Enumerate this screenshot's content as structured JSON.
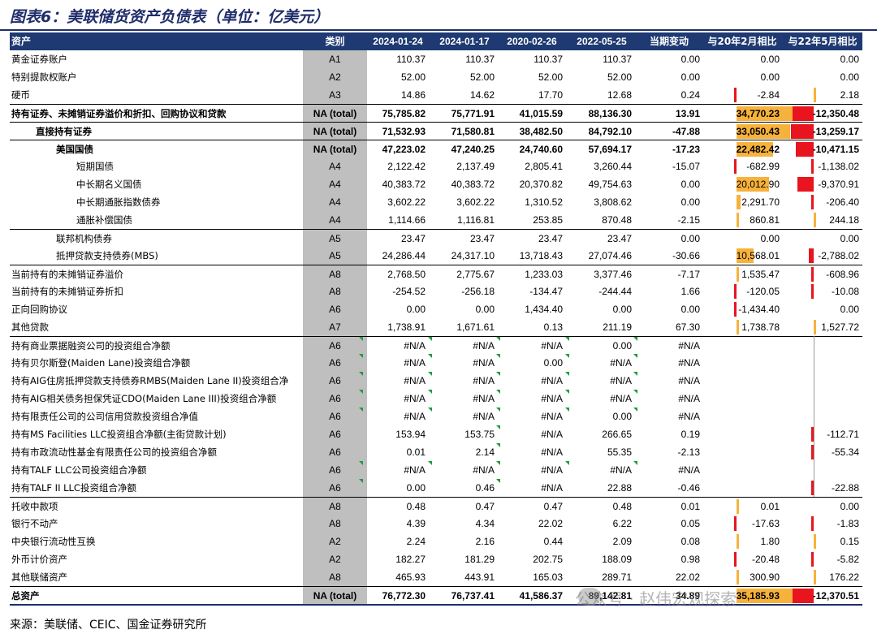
{
  "title": "图表6：美联储货资产负债表（单位：亿美元）",
  "headers": [
    "资产",
    "类别",
    "2024-01-24",
    "2024-01-17",
    "2020-02-26",
    "2022-05-25",
    "当期变动",
    "与20年2月相比",
    "与22年5月相比"
  ],
  "rows": [
    {
      "label": "黄金证券账户",
      "cat": "A1",
      "v": [
        "110.37",
        "110.37",
        "110.37",
        "110.37",
        "0.00",
        "0.00",
        "0.00"
      ]
    },
    {
      "label": "特别提款权账户",
      "cat": "A2",
      "v": [
        "52.00",
        "52.00",
        "52.00",
        "52.00",
        "0.00",
        "0.00",
        "0.00"
      ]
    },
    {
      "label": "硬币",
      "cat": "A3",
      "v": [
        "14.86",
        "14.62",
        "17.70",
        "12.68",
        "0.24",
        "-2.84",
        "2.18"
      ]
    },
    {
      "label": "持有证券、未摊销证券溢价和折扣、回购协议和贷款",
      "cat": "NA (total)",
      "v": [
        "75,785.82",
        "75,771.91",
        "41,015.59",
        "88,136.30",
        "13.91",
        "34,770.23",
        "-12,350.48"
      ]
    },
    {
      "label": "直接持有证券",
      "cat": "NA (total)",
      "v": [
        "71,532.93",
        "71,580.81",
        "38,482.50",
        "84,792.10",
        "-47.88",
        "33,050.43",
        "-13,259.17"
      ]
    },
    {
      "label": "美国国债",
      "cat": "NA (total)",
      "v": [
        "47,223.02",
        "47,240.25",
        "24,740.60",
        "57,694.17",
        "-17.23",
        "22,482.42",
        "-10,471.15"
      ]
    },
    {
      "label": "短期国债",
      "cat": "A4",
      "v": [
        "2,122.42",
        "2,137.49",
        "2,805.41",
        "3,260.44",
        "-15.07",
        "-682.99",
        "-1,138.02"
      ]
    },
    {
      "label": "中长期名义国债",
      "cat": "A4",
      "v": [
        "40,383.72",
        "40,383.72",
        "20,370.82",
        "49,754.63",
        "0.00",
        "20,012.90",
        "-9,370.91"
      ]
    },
    {
      "label": "中长期通胀指数债券",
      "cat": "A4",
      "v": [
        "3,602.22",
        "3,602.22",
        "1,310.52",
        "3,808.62",
        "0.00",
        "2,291.70",
        "-206.40"
      ]
    },
    {
      "label": "通胀补偿国债",
      "cat": "A4",
      "v": [
        "1,114.66",
        "1,116.81",
        "253.85",
        "870.48",
        "-2.15",
        "860.81",
        "244.18"
      ]
    },
    {
      "label": "联邦机构债券",
      "cat": "A5",
      "v": [
        "23.47",
        "23.47",
        "23.47",
        "23.47",
        "0.00",
        "0.00",
        "0.00"
      ]
    },
    {
      "label": "抵押贷款支持债券(MBS)",
      "cat": "A5",
      "v": [
        "24,286.44",
        "24,317.10",
        "13,718.43",
        "27,074.46",
        "-30.66",
        "10,568.01",
        "-2,788.02"
      ]
    },
    {
      "label": "当前持有的未摊销证券溢价",
      "cat": "A8",
      "v": [
        "2,768.50",
        "2,775.67",
        "1,233.03",
        "3,377.46",
        "-7.17",
        "1,535.47",
        "-608.96"
      ]
    },
    {
      "label": "当前持有的未摊销证券折扣",
      "cat": "A8",
      "v": [
        "-254.52",
        "-256.18",
        "-134.47",
        "-244.44",
        "1.66",
        "-120.05",
        "-10.08"
      ]
    },
    {
      "label": "正向回购协议",
      "cat": "A6",
      "v": [
        "0.00",
        "0.00",
        "1,434.40",
        "0.00",
        "0.00",
        "-1,434.40",
        "0.00"
      ]
    },
    {
      "label": "其他贷款",
      "cat": "A7",
      "v": [
        "1,738.91",
        "1,671.61",
        "0.13",
        "211.19",
        "67.30",
        "1,738.78",
        "1,527.72"
      ]
    },
    {
      "label": "持有商业票据融资公司的投资组合净额",
      "cat": "A6",
      "v": [
        "#N/A",
        "#N/A",
        "#N/A",
        "0.00",
        "#N/A",
        "",
        ""
      ]
    },
    {
      "label": "持有贝尔斯登(Maiden Lane)投资组合净额",
      "cat": "A6",
      "v": [
        "#N/A",
        "#N/A",
        "0.00",
        "#N/A",
        "#N/A",
        "",
        ""
      ]
    },
    {
      "label": "持有AIG住房抵押贷款支持债券RMBS(Maiden Lane II)投资组合净",
      "cat": "A6",
      "v": [
        "#N/A",
        "#N/A",
        "#N/A",
        "#N/A",
        "#N/A",
        "",
        ""
      ]
    },
    {
      "label": "持有AIG相关债务担保凭证CDO(Maiden Lane III)投资组合净额",
      "cat": "A6",
      "v": [
        "#N/A",
        "#N/A",
        "#N/A",
        "#N/A",
        "#N/A",
        "",
        ""
      ]
    },
    {
      "label": "持有限责任公司的公司信用贷款投资组合净值",
      "cat": "A6",
      "v": [
        "#N/A",
        "#N/A",
        "#N/A",
        "0.00",
        "#N/A",
        "",
        ""
      ]
    },
    {
      "label": "持有MS Facilities LLC投资组合净额(主街贷款计划)",
      "cat": "A6",
      "v": [
        "153.94",
        "153.75",
        "#N/A",
        "266.65",
        "0.19",
        "",
        "-112.71"
      ]
    },
    {
      "label": "持有市政流动性基金有限责任公司的投资组合净额",
      "cat": "A6",
      "v": [
        "0.01",
        "2.14",
        "#N/A",
        "55.35",
        "-2.13",
        "",
        "-55.34"
      ]
    },
    {
      "label": "持有TALF LLC公司投资组合净额",
      "cat": "A6",
      "v": [
        "#N/A",
        "#N/A",
        "#N/A",
        "#N/A",
        "#N/A",
        "",
        ""
      ]
    },
    {
      "label": "持有TALF II LLC投资组合净额",
      "cat": "A6",
      "v": [
        "0.00",
        "0.46",
        "#N/A",
        "22.88",
        "-0.46",
        "",
        "-22.88"
      ]
    },
    {
      "label": "托收中款项",
      "cat": "A8",
      "v": [
        "0.48",
        "0.47",
        "0.47",
        "0.48",
        "0.01",
        "0.01",
        "0.00"
      ]
    },
    {
      "label": "银行不动产",
      "cat": "A8",
      "v": [
        "4.39",
        "4.34",
        "22.02",
        "6.22",
        "0.05",
        "-17.63",
        "-1.83"
      ]
    },
    {
      "label": "中央银行流动性互换",
      "cat": "A2",
      "v": [
        "2.24",
        "2.16",
        "0.44",
        "2.09",
        "0.08",
        "1.80",
        "0.15"
      ]
    },
    {
      "label": "外币计价资产",
      "cat": "A2",
      "v": [
        "182.27",
        "181.29",
        "202.75",
        "188.09",
        "0.98",
        "-20.48",
        "-5.82"
      ]
    },
    {
      "label": "其他联储资产",
      "cat": "A8",
      "v": [
        "465.93",
        "443.91",
        "165.03",
        "289.71",
        "22.02",
        "300.90",
        "176.22"
      ]
    },
    {
      "label": "总资产",
      "cat": "NA (total)",
      "v": [
        "76,772.30",
        "76,737.41",
        "41,586.37",
        "89,142.81",
        "34.89",
        "35,185.93",
        "-12,370.51"
      ]
    }
  ],
  "watermark": "公众号 · 赵伟宏观探索",
  "source": "来源：美联储、CEIC、国金证券研究所",
  "colors": {
    "header_bg": "#1f3a72",
    "title": "#1f2d6b",
    "category_bg": "#bfbfbf",
    "bar_positive": "#f7b23b",
    "bar_negative": "#e8141e",
    "flag_marker": "#1a9e3a"
  }
}
